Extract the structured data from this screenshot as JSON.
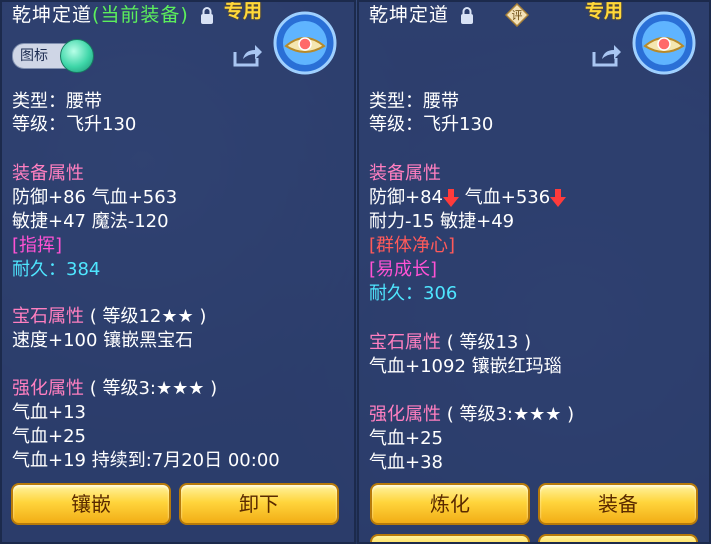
{
  "left": {
    "title": "乾坤定道",
    "title_sub": "(当前装备)",
    "exclusive": "专用",
    "toggle_label": "图标",
    "type_line": "类型：腰带",
    "level_line": "等级：飞升130",
    "equip_header": "装备属性",
    "equip_line1": "防御+86 气血+563",
    "equip_line2": "敏捷+47 魔法-120",
    "special_tag": "[指挥]",
    "durability_label": "耐久：",
    "durability_value": "384",
    "gem_header": "宝石属性",
    "gem_level": "( 等级12★★ )",
    "gem_line": "速度+100 镶嵌黑宝石",
    "enhance_header": "强化属性",
    "enhance_level": "( 等级3:★★★ )",
    "enhance_line1": "气血+13",
    "enhance_line2": "气血+25",
    "enhance_line3": "气血+19   持续到:7月20日 00:00",
    "btn_inlay": "镶嵌",
    "btn_unequip": "卸下"
  },
  "right": {
    "title": "乾坤定道",
    "rate_label": "评",
    "exclusive": "专用",
    "type_line": "类型：腰带",
    "level_line": "等级：飞升130",
    "equip_header": "装备属性",
    "equip_def": "防御+84",
    "equip_hp": "气血+536",
    "equip_line2": "耐力-15 敏捷+49",
    "special_tag1": "[群体净心]",
    "special_tag2": "[易成长]",
    "durability_label": "耐久：",
    "durability_value": "306",
    "gem_header": "宝石属性",
    "gem_level": "( 等级13 )",
    "gem_line": "气血+1092 镶嵌红玛瑙",
    "enhance_header": "强化属性",
    "enhance_level": "( 等级3:★★★ )",
    "enhance_line1": "气血+25",
    "enhance_line2": "气血+38",
    "btn_refine": "炼化",
    "btn_equip": "装备"
  },
  "colors": {
    "accent_gold": "#ffd83a",
    "section_pink": "#ff7fc0",
    "tag_magenta": "#ff52d4",
    "tag_red": "#ff5a5a",
    "value_cyan": "#4fe6ff",
    "green_sub": "#5cf05c"
  }
}
